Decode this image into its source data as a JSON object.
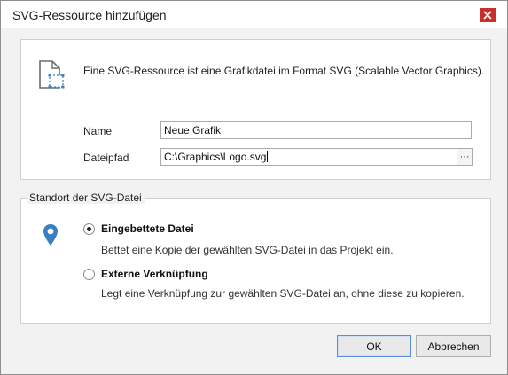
{
  "window": {
    "title": "SVG-Ressource hinzufügen"
  },
  "intro": {
    "description": "Eine SVG-Ressource ist eine Grafikdatei im Format SVG (Scalable Vector Graphics)."
  },
  "form": {
    "name_label": "Name",
    "name_value": "Neue Grafik",
    "path_label": "Dateipfad",
    "path_value": "C:\\Graphics\\Logo.svg",
    "browse_label": "···"
  },
  "location": {
    "group_title": "Standort der SVG-Datei",
    "options": [
      {
        "label": "Eingebettete Datei",
        "description": "Bettet eine Kopie der gewählten SVG-Datei in das Projekt ein.",
        "checked": true
      },
      {
        "label": "Externe Verknüpfung",
        "description": "Legt eine Verknüpfung zur gewählten SVG-Datei an, ohne diese zu kopieren.",
        "checked": false
      }
    ]
  },
  "buttons": {
    "ok": "OK",
    "cancel": "Abbrechen"
  },
  "icons": {
    "resource": "svg-file-icon",
    "location": "location-pin-icon",
    "close": "close-icon"
  },
  "colors": {
    "close_button": "#c9302c",
    "pin": "#3a7fc1",
    "ok_border": "#5a8fd6"
  }
}
